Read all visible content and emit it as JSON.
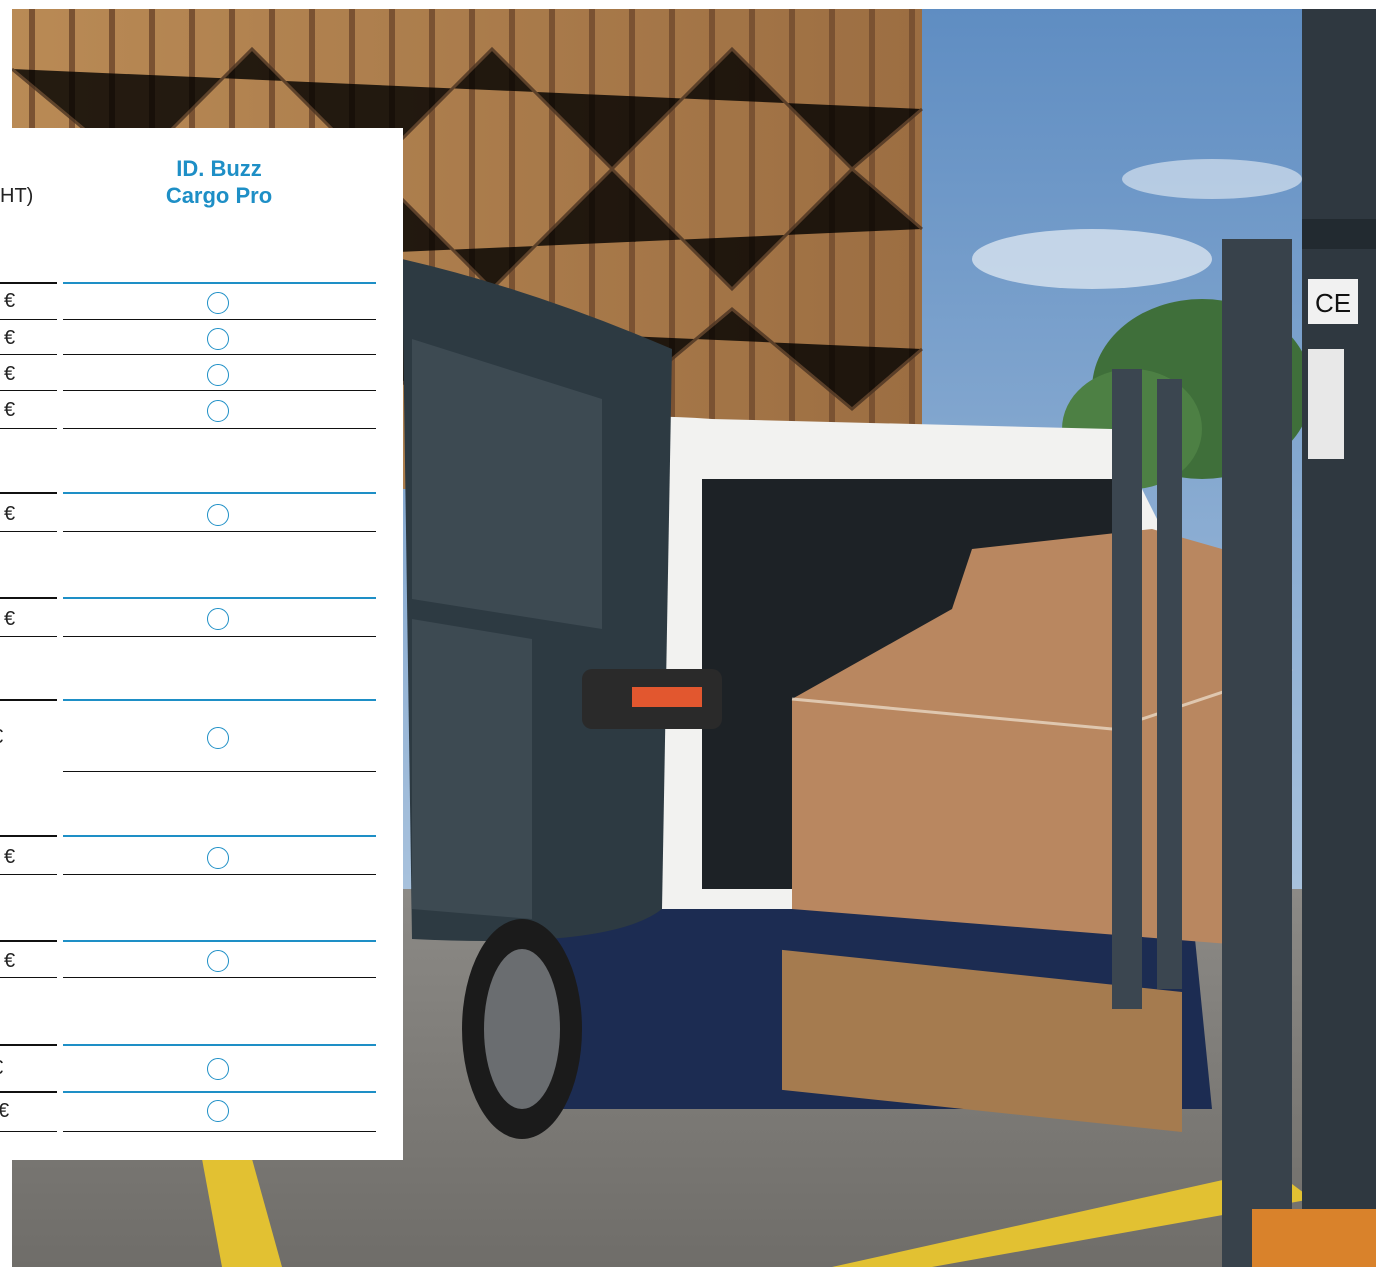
{
  "column_header": {
    "line1": "ID. Buzz",
    "line2": "Cargo Pro"
  },
  "price_header_fragment": "HT)",
  "rows": [
    {
      "price": "€",
      "option": "circle-outline-icon"
    },
    {
      "price": "€",
      "option": "circle-outline-icon"
    },
    {
      "price": "€",
      "option": "circle-outline-icon"
    },
    {
      "price": "€",
      "option": "circle-outline-icon"
    },
    {
      "price": "€",
      "option": "circle-outline-icon"
    },
    {
      "price": "€",
      "option": "circle-outline-icon"
    },
    {
      "price": "€",
      "option": "circle-outline-icon"
    },
    {
      "price": "€",
      "option": "circle-outline-icon"
    },
    {
      "price": "€",
      "option": "circle-outline-icon"
    },
    {
      "price": "€",
      "option": "circle-outline-icon"
    },
    {
      "price": "€",
      "option": "circle-outline-icon"
    }
  ],
  "photo": {
    "sticker_text": "CE"
  },
  "colors": {
    "accent": "#1e8fc6",
    "rule": "#111111",
    "text": "#222222"
  }
}
